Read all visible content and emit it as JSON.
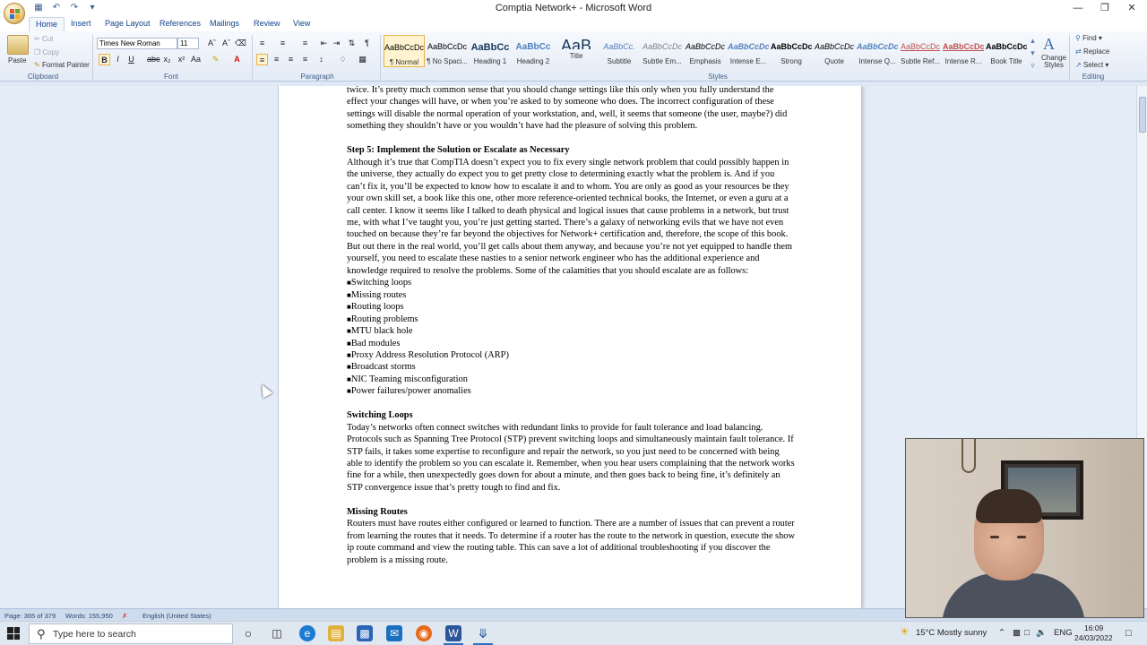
{
  "window": {
    "title": "Comptia Network+ - Microsoft Word"
  },
  "ribbon_tabs": [
    "Home",
    "Insert",
    "Page Layout",
    "References",
    "Mailings",
    "Review",
    "View"
  ],
  "clipboard": {
    "paste": "Paste",
    "cut": "Cut",
    "copy": "Copy",
    "format_painter": "Format Painter",
    "label": "Clipboard"
  },
  "font": {
    "name": "Times New Roman",
    "size": "11",
    "label": "Font"
  },
  "paragraph": {
    "label": "Paragraph"
  },
  "styles": {
    "label": "Styles",
    "items": [
      {
        "sample": "AaBbCcDc",
        "name": "¶ Normal"
      },
      {
        "sample": "AaBbCcDc",
        "name": "¶ No Spaci..."
      },
      {
        "sample": "AaBbCc",
        "name": "Heading 1"
      },
      {
        "sample": "AaBbCc",
        "name": "Heading 2"
      },
      {
        "sample": "AaB",
        "name": "Title"
      },
      {
        "sample": "AaBbCc.",
        "name": "Subtitle"
      },
      {
        "sample": "AaBbCcDc",
        "name": "Subtle Em..."
      },
      {
        "sample": "AaBbCcDc",
        "name": "Emphasis"
      },
      {
        "sample": "AaBbCcDc",
        "name": "Intense E..."
      },
      {
        "sample": "AaBbCcDc",
        "name": "Strong"
      },
      {
        "sample": "AaBbCcDc",
        "name": "Quote"
      },
      {
        "sample": "AaBbCcDc",
        "name": "Intense Q..."
      },
      {
        "sample": "AaBbCcDc",
        "name": "Subtle Ref..."
      },
      {
        "sample": "AaBbCcDc",
        "name": "Intense R..."
      },
      {
        "sample": "AaBbCcDc",
        "name": "Book Title"
      }
    ],
    "change_styles": "Change Styles"
  },
  "editing": {
    "find": "Find",
    "replace": "Replace",
    "select": "Select",
    "label": "Editing"
  },
  "document": {
    "para1": "twice. It’s pretty much common sense that you should change settings like this only when you fully understand the effect your changes will have, or when you’re asked to by someone who does. The incorrect configuration of these settings will disable the normal operation of your workstation, and, well, it seems that someone (the user, maybe?) did something they shouldn’t have or you wouldn’t have had the pleasure of solving this problem.",
    "step5_heading": "Step 5: Implement the Solution or Escalate as Necessary",
    "step5_body": "Although it’s true that CompTIA doesn’t expect you to fix every single network problem that could possibly happen in the universe, they actually do expect you to get pretty close to determining exactly what the problem is. And if you can’t fix it, you’ll be expected to know how to escalate it and to whom. You are only as good as your resources be they your own skill set, a book like this one, other more reference-oriented technical books, the Internet, or even a guru at a call center. I know it seems like I talked to death physical and logical issues that cause problems in a network, but trust me, with what I’ve taught you, you’re just getting started. There’s a galaxy of networking evils that we have not even touched on because they’re far beyond the objectives for Network+ certification and, therefore, the scope of this book. But out there in the real world, you’ll get calls about them anyway, and because you’re not yet equipped to handle them yourself, you need to escalate these nasties to a senior network engineer who has the additional experience and knowledge required to resolve the problems. Some of the calamities that you should escalate are as follows:",
    "bullets": [
      "Switching loops",
      "Missing routes",
      "Routing loops",
      "Routing problems",
      "MTU black hole",
      "Bad modules",
      "Proxy Address Resolution Protocol (ARP)",
      "Broadcast storms",
      "NIC Teaming misconfiguration",
      "Power failures/power anomalies"
    ],
    "switching_heading": "Switching Loops",
    "switching_body": "Today’s networks often connect switches with redundant links to provide for fault tolerance and load balancing. Protocols such as Spanning Tree Protocol (STP) prevent switching loops and simultaneously maintain fault tolerance. If STP fails, it takes some expertise to reconfigure and repair the network, so you just need to be concerned with being able to identify the problem so you can escalate it. Remember, when you hear users complaining that the network works fine for a while, then unexpectedly goes down for about a minute, and then goes back to being fine, it’s definitely an STP convergence issue that’s pretty tough to find and fix.",
    "missing_heading": "Missing Routes",
    "missing_body": "Routers must have routes either configured or learned to function. There are a number of issues that can prevent a router from learning the routes that it needs. To determine if a router has the route to the network in question, execute the show ip route command and view the routing table. This can save a lot of additional troubleshooting if you discover the problem is a missing route."
  },
  "status_bar": {
    "page": "Page: 365 of 379",
    "words": "Words: 155,950",
    "language": "English (United States)"
  },
  "taskbar": {
    "search_placeholder": "Type here to search",
    "weather": "15°C  Mostly sunny",
    "lang": "ENG",
    "time": "16:09",
    "date": "24/03/2022"
  }
}
